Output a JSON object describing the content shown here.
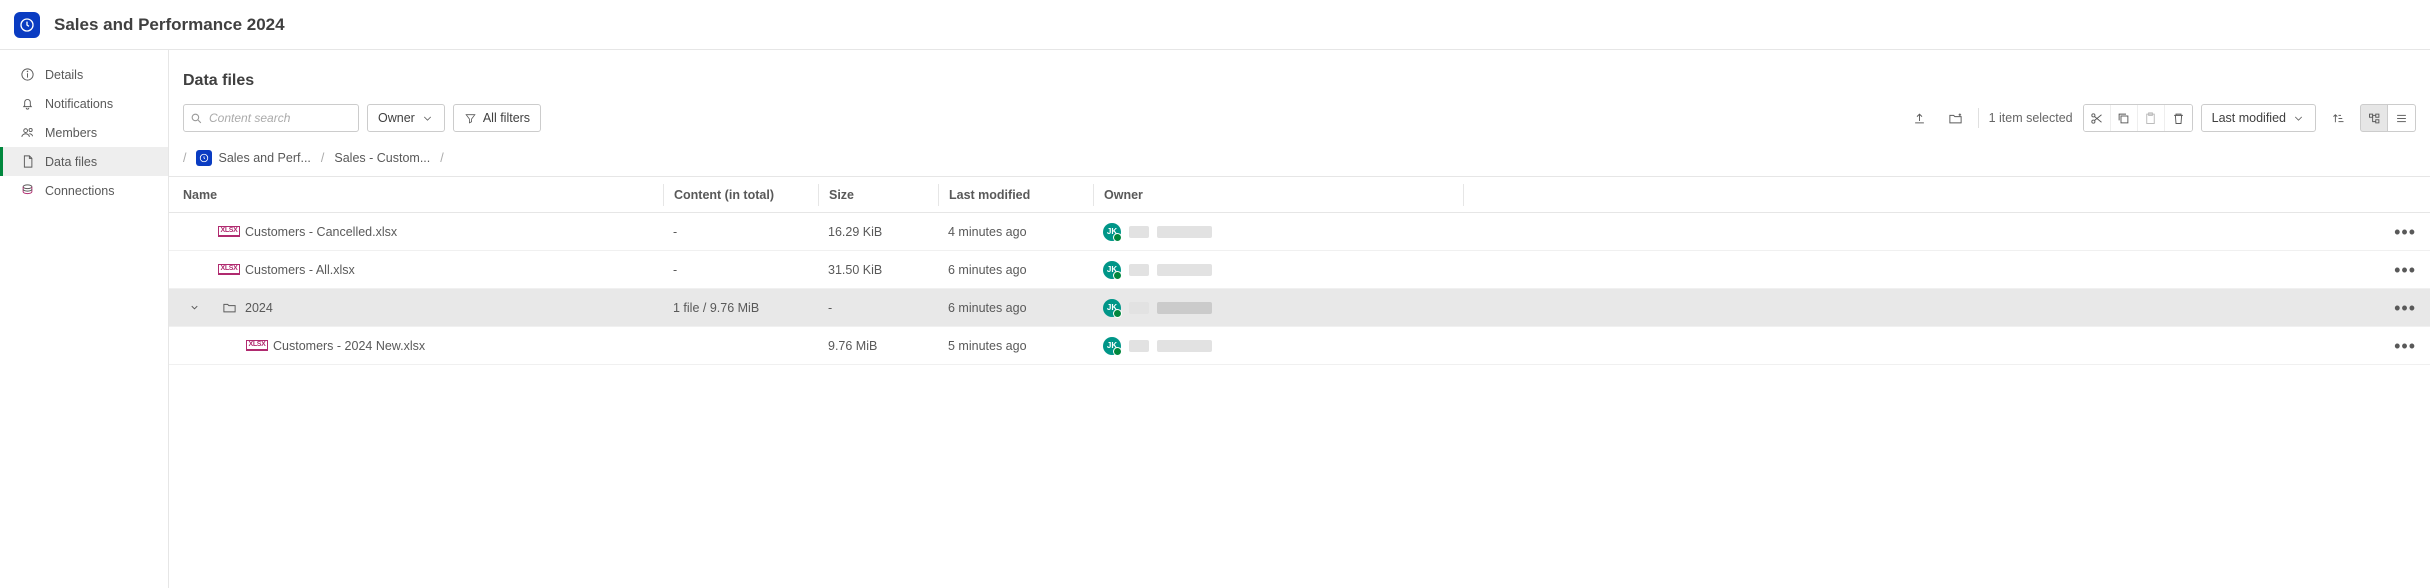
{
  "header": {
    "title": "Sales and Performance 2024"
  },
  "sidebar": {
    "items": [
      {
        "label": "Details"
      },
      {
        "label": "Notifications"
      },
      {
        "label": "Members"
      },
      {
        "label": "Data files"
      },
      {
        "label": "Connections"
      }
    ]
  },
  "section": {
    "title": "Data files"
  },
  "toolbar": {
    "search_placeholder": "Content search",
    "owner_label": "Owner",
    "all_filters_label": "All filters",
    "selection_text": "1 item selected",
    "sort_label": "Last modified"
  },
  "breadcrumb": {
    "root": "Sales and Perf...",
    "current": "Sales - Custom..."
  },
  "columns": {
    "name": "Name",
    "content": "Content (in total)",
    "size": "Size",
    "modified": "Last modified",
    "owner": "Owner"
  },
  "rows": [
    {
      "type": "file",
      "name": "Customers - Cancelled.xlsx",
      "content": "-",
      "size": "16.29 KiB",
      "modified": "4 minutes ago",
      "owner_initials": "JK",
      "indent": 0,
      "icon": "xlsx"
    },
    {
      "type": "file",
      "name": "Customers - All.xlsx",
      "content": "-",
      "size": "31.50 KiB",
      "modified": "6 minutes ago",
      "owner_initials": "JK",
      "indent": 0,
      "icon": "xlsx"
    },
    {
      "type": "folder",
      "name": "2024",
      "content": "1 file / 9.76 MiB",
      "size": "-",
      "modified": "6 minutes ago",
      "owner_initials": "JK",
      "indent": 0,
      "expanded": true,
      "selected": true,
      "icon": "folder"
    },
    {
      "type": "file",
      "name": "Customers - 2024 New.xlsx",
      "content": "",
      "size": "9.76 MiB",
      "modified": "5 minutes ago",
      "owner_initials": "JK",
      "indent": 1,
      "icon": "xlsx"
    }
  ]
}
